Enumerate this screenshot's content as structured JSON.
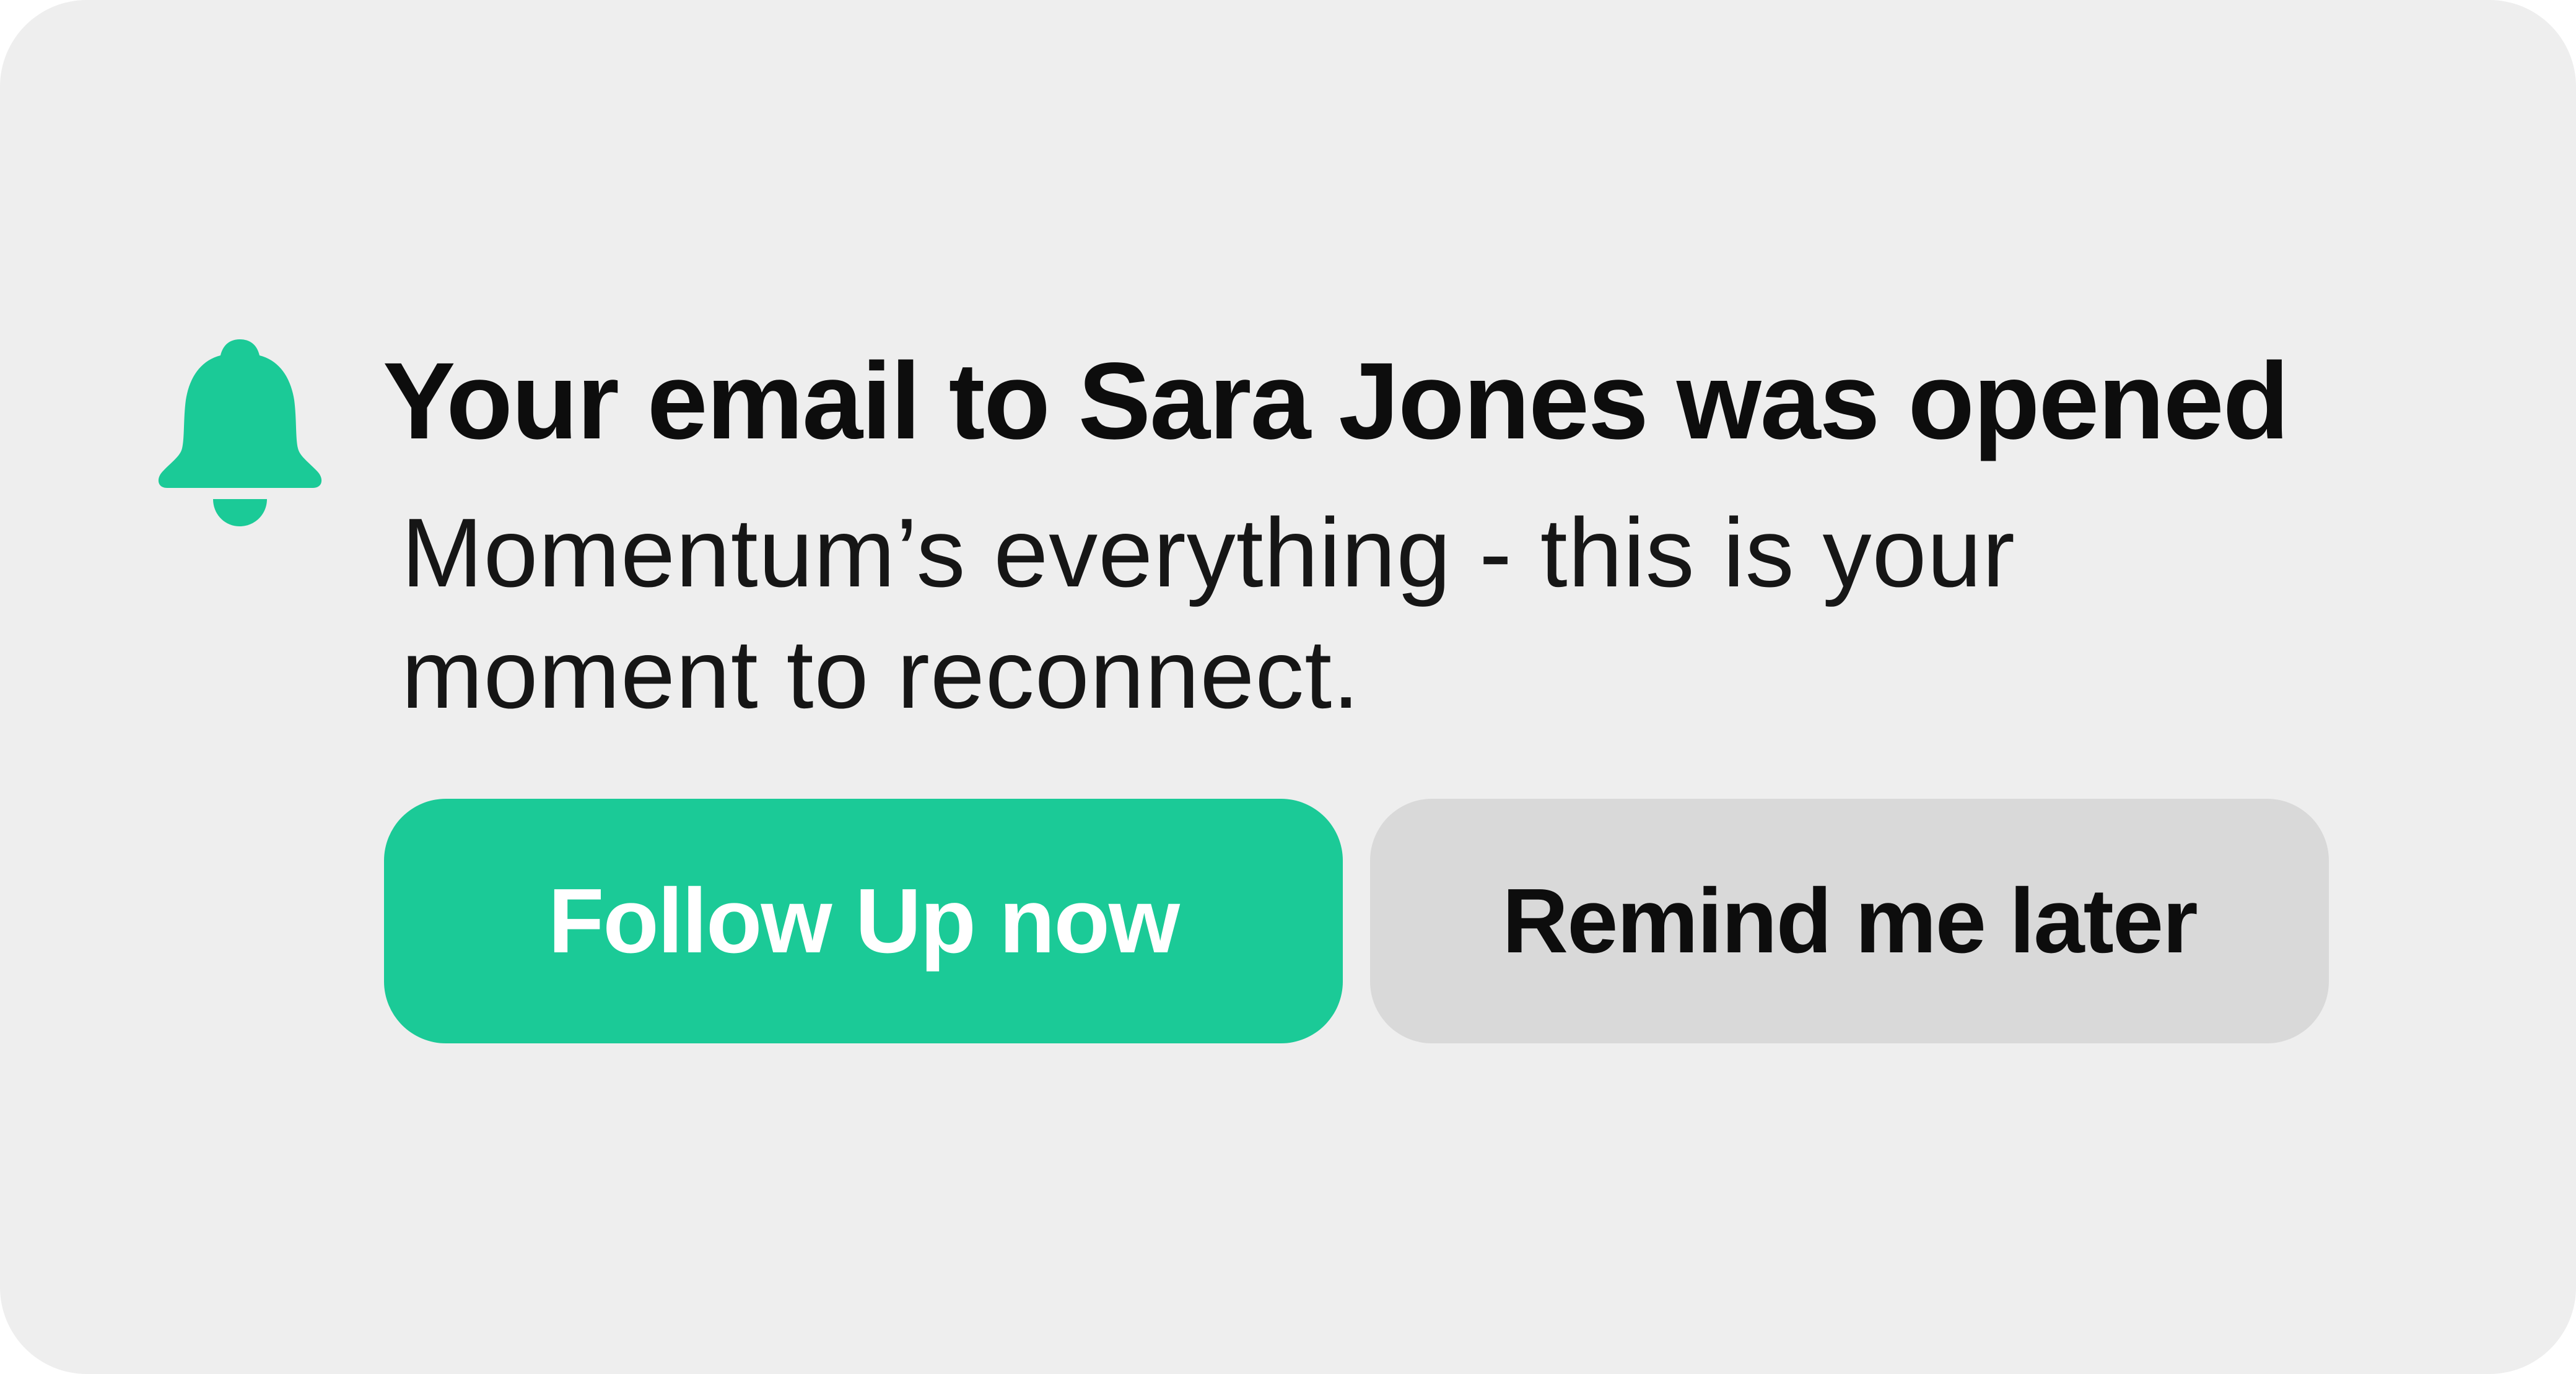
{
  "colors": {
    "card_background": "#eeeeee",
    "accent": "#1bca97",
    "secondary_button": "#d9d9d9",
    "text": "#0d0d0d"
  },
  "notification": {
    "icon": "bell-icon",
    "title": "Your email  to Sara Jones was opened",
    "message": "Momentum’s everything  - this is your moment to reconnect."
  },
  "actions": {
    "primary_label": "Follow Up now",
    "secondary_label": "Remind me later"
  }
}
